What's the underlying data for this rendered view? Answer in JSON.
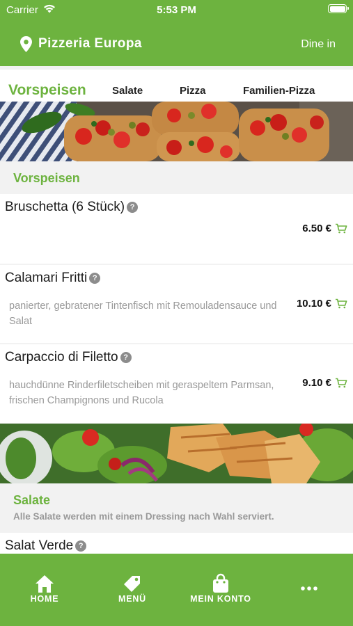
{
  "status": {
    "carrier": "Carrier",
    "time": "5:53 PM"
  },
  "header": {
    "restaurant": "Pizzeria Europa",
    "mode": "Dine in"
  },
  "tabs": [
    {
      "label": "Vorspeisen",
      "active": true
    },
    {
      "label": "Salate",
      "active": false
    },
    {
      "label": "Pizza",
      "active": false
    },
    {
      "label": "Familien-Pizza",
      "active": false
    }
  ],
  "sections": {
    "vorspeisen": {
      "title": "Vorspeisen",
      "items": [
        {
          "name": "Bruschetta (6 Stück)",
          "description": "",
          "price": "6.50 €"
        },
        {
          "name": "Calamari Fritti",
          "description": "panierter, gebratener Tintenfisch mit Remouladensauce und Salat",
          "price": "10.10 €"
        },
        {
          "name": "Carpaccio di Filetto",
          "description": "hauchdünne Rinderfiletscheiben mit geraspeltem Parmsan, frischen Champignons und Rucola",
          "price": "9.10 €"
        }
      ]
    },
    "salate": {
      "title": "Salate",
      "subtitle": "Alle Salate werden mit einem Dressing nach Wahl serviert.",
      "items": [
        {
          "name": "Salat Verde"
        }
      ]
    }
  },
  "help_glyph": "?",
  "nav": [
    {
      "label": "HOME",
      "icon": "home-icon"
    },
    {
      "label": "MENÜ",
      "icon": "tag-icon"
    },
    {
      "label": "MEIN KONTO",
      "icon": "shopping-bag-icon"
    },
    {
      "label": "",
      "icon": "more-icon"
    }
  ],
  "colors": {
    "brand": "#6db33f",
    "background": "#f2f2f2",
    "muted_text": "#999999"
  }
}
